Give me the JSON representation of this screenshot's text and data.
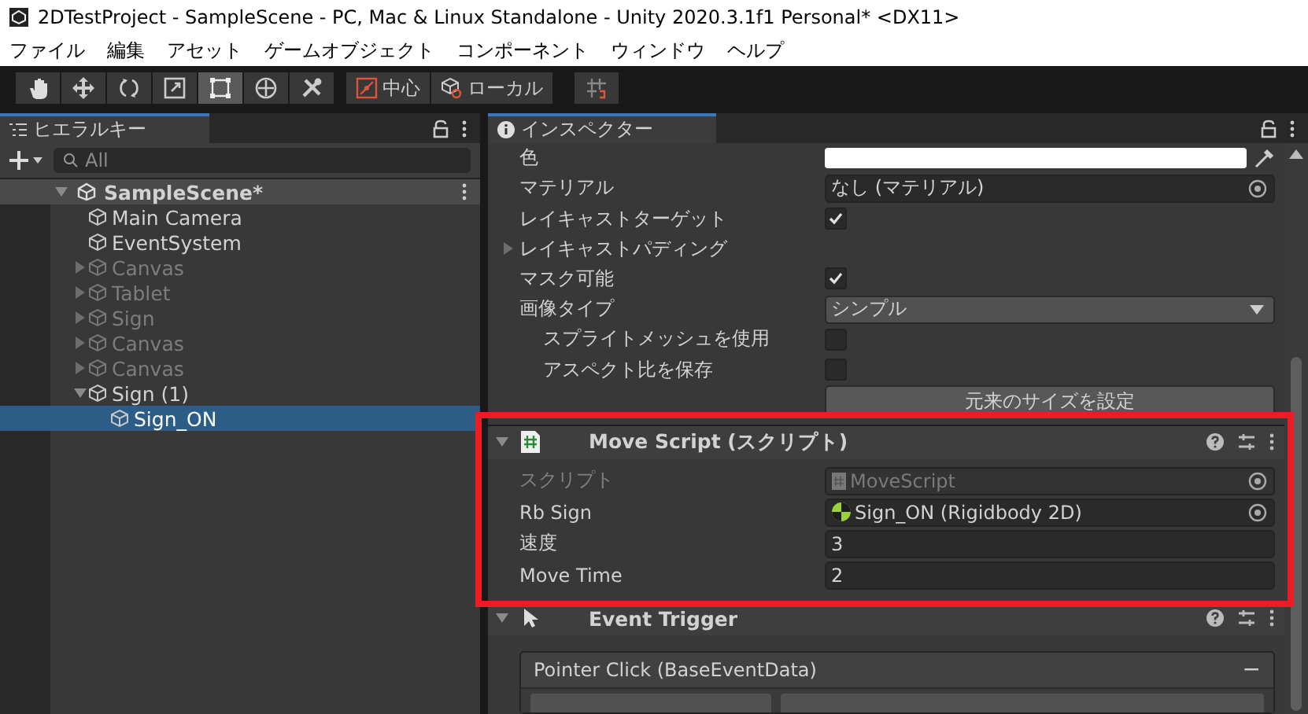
{
  "window": {
    "title": "2DTestProject - SampleScene - PC, Mac & Linux Standalone - Unity 2020.3.1f1 Personal* <DX11>"
  },
  "menu": [
    "ファイル",
    "編集",
    "アセット",
    "ゲームオブジェクト",
    "コンポーネント",
    "ウィンドウ",
    "ヘルプ"
  ],
  "toolbar": {
    "tools": [
      {
        "selected": false
      },
      {
        "selected": false
      },
      {
        "selected": false
      },
      {
        "selected": false
      },
      {
        "selected": true
      },
      {
        "selected": false
      },
      {
        "selected": false
      }
    ],
    "pivot_buttons": [
      "中心",
      "ローカル"
    ]
  },
  "hierarchy": {
    "tab": "ヒエラルキー",
    "search": {
      "placeholder": "All"
    },
    "scene": {
      "name": "SampleScene*",
      "expanded": true,
      "children": [
        {
          "name": "Main Camera",
          "active": true,
          "selected": false
        },
        {
          "name": "EventSystem",
          "active": true,
          "selected": false
        },
        {
          "name": "Canvas",
          "active": false,
          "selected": false,
          "expanded": false
        },
        {
          "name": "Tablet",
          "active": false,
          "selected": false,
          "expanded": false
        },
        {
          "name": "Sign",
          "active": false,
          "selected": false,
          "expanded": false
        },
        {
          "name": "Canvas",
          "active": false,
          "selected": false,
          "expanded": false
        },
        {
          "name": "Canvas",
          "active": false,
          "selected": false,
          "expanded": false
        },
        {
          "name": "Sign (1)",
          "active": true,
          "selected": false,
          "expanded": true,
          "children": [
            {
              "name": "Sign_ON",
              "active": true,
              "selected": true
            }
          ]
        }
      ]
    }
  },
  "inspector": {
    "tab": "インスペクター",
    "properties": [
      {
        "kind": "color",
        "label": "色"
      },
      {
        "kind": "object",
        "label": "マテリアル",
        "value": "なし (マテリアル)"
      },
      {
        "kind": "checkbox",
        "label": "レイキャストターゲット",
        "checked": true
      },
      {
        "kind": "foldout",
        "label": "レイキャストパディング",
        "expanded": false
      },
      {
        "kind": "checkbox",
        "label": "マスク可能",
        "checked": true
      },
      {
        "kind": "dropdown",
        "label": "画像タイプ",
        "value": "シンプル",
        "children": [
          {
            "kind": "checkbox",
            "label": "スプライトメッシュを使用",
            "checked": false
          },
          {
            "kind": "checkbox",
            "label": "アスペクト比を保存",
            "checked": false
          }
        ]
      },
      {
        "kind": "button",
        "text": "元来のサイズを設定"
      }
    ],
    "components": [
      {
        "title": "Move Script (スクリプト)",
        "expanded": true,
        "fields": [
          {
            "kind": "script",
            "label": "スクリプト",
            "value": "MoveScript",
            "disabled": true
          },
          {
            "kind": "component",
            "label": "Rb Sign",
            "value": "Sign_ON (Rigidbody 2D)",
            "disabled": false
          },
          {
            "kind": "number",
            "label": "速度",
            "value": "3",
            "disabled": false
          },
          {
            "kind": "number",
            "label": "Move Time",
            "value": "2",
            "disabled": false
          }
        ]
      },
      {
        "title": "Event Trigger",
        "expanded": true,
        "events": [
          {
            "name": "Pointer Click (BaseEventData)",
            "remove": "−"
          }
        ]
      }
    ]
  }
}
